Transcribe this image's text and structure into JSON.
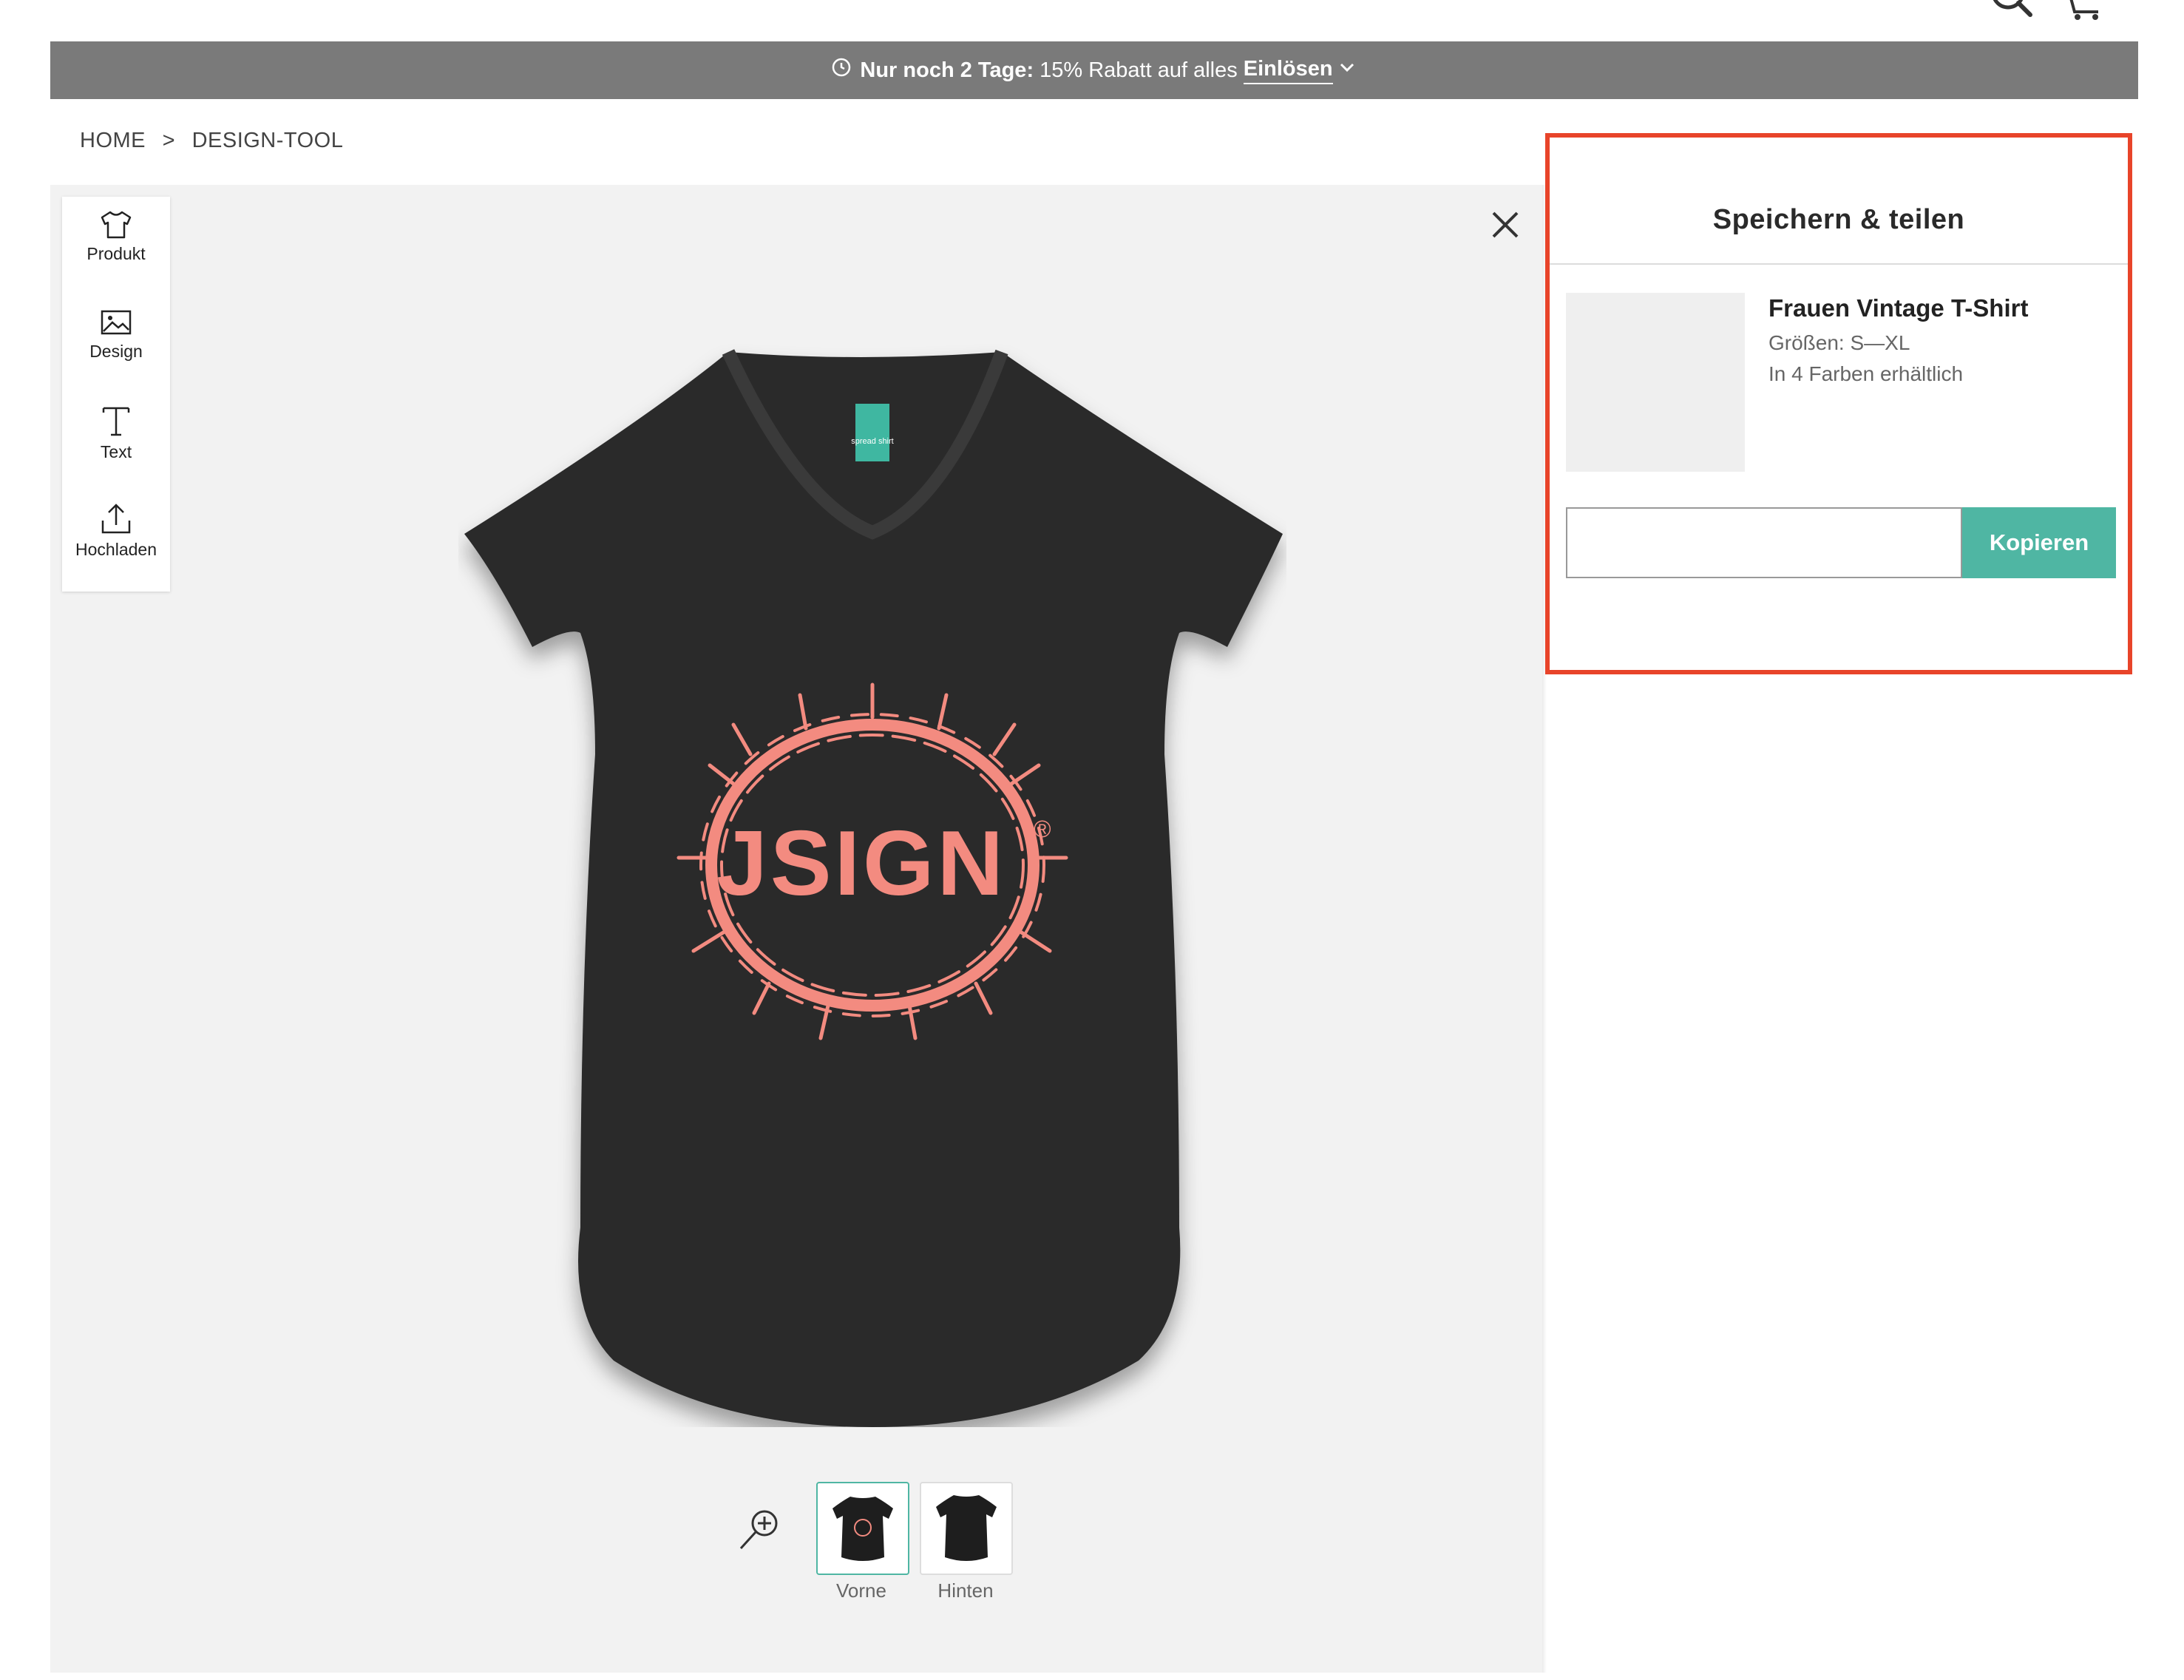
{
  "header": {
    "icons": [
      "search-icon",
      "cart-icon"
    ]
  },
  "promo": {
    "bold_text": "Nur noch 2 Tage:",
    "text": "15% Rabatt auf alles",
    "link": "Einlösen",
    "icons": [
      "clock-icon",
      "chevron-down-icon"
    ]
  },
  "breadcrumb": {
    "home": "HOME",
    "separator": ">",
    "current": "DESIGN-TOOL"
  },
  "toolbar": {
    "items": [
      {
        "label": "Produkt",
        "icon": "tshirt-icon"
      },
      {
        "label": "Design",
        "icon": "image-icon"
      },
      {
        "label": "Text",
        "icon": "text-icon"
      },
      {
        "label": "Hochladen",
        "icon": "upload-icon"
      }
    ]
  },
  "canvas": {
    "design_text": "JSIGN",
    "design_mark": "®",
    "shirt_tag": "spread shirt",
    "views": [
      {
        "label": "Vorne",
        "active": true
      },
      {
        "label": "Hinten",
        "active": false
      }
    ],
    "icons": [
      "close-icon",
      "zoom-in-icon"
    ]
  },
  "panel": {
    "title": "Speichern & teilen",
    "product": {
      "name": "Frauen Vintage T-Shirt",
      "sizes": "Größen: S—XL",
      "colors": "In 4 Farben erhältlich"
    },
    "link_value": "",
    "copy_label": "Kopieren"
  },
  "colors": {
    "accent": "#4fb6a3",
    "banner": "#7a7a7a",
    "highlight": "#e8442a",
    "shirt": "#2b2b2b",
    "design": "#f38b80"
  }
}
